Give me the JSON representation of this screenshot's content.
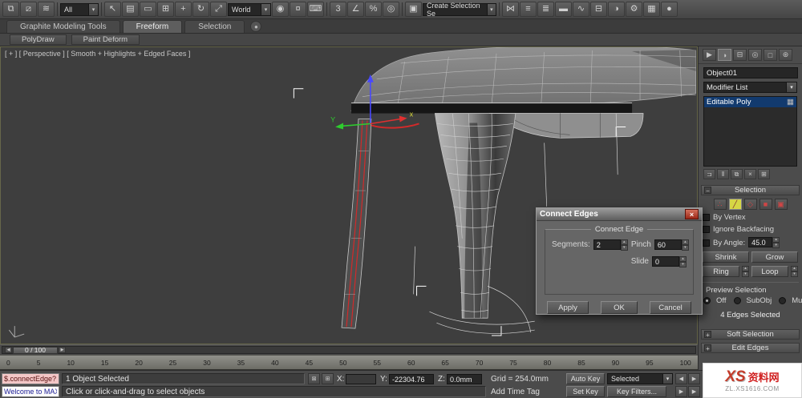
{
  "glyphs": {
    "dropdown_arrow": "▾",
    "spin_up": "▴",
    "spin_down": "▾",
    "collapse": "−",
    "expand": "+",
    "close": "×",
    "lock": "⊠",
    "absolute_mode": "⊞",
    "prev": "◀",
    "next": "▶",
    "modifier_icon": "▦",
    "ribbon_min": "●",
    "slider_left": "◀",
    "slider_right": "▶"
  },
  "toolbar": {
    "selection_filter": "All",
    "coord_system": "World",
    "named_sets": "Create Selection Se",
    "group1": [
      {
        "name": "select-and-link-icon",
        "glyph": "⧉"
      },
      {
        "name": "unlink-selection-icon",
        "glyph": "⧄"
      },
      {
        "name": "bind-to-spacewarp-icon",
        "glyph": "≋"
      }
    ],
    "group2": [
      {
        "name": "select-object-icon",
        "glyph": "↖"
      },
      {
        "name": "select-by-name-icon",
        "glyph": "▤"
      },
      {
        "name": "selection-region-icon",
        "glyph": "▭"
      },
      {
        "name": "window-crossing-icon",
        "glyph": "⊞"
      },
      {
        "name": "select-and-move-icon",
        "glyph": "+"
      },
      {
        "name": "select-and-rotate-icon",
        "glyph": "↻"
      },
      {
        "name": "select-and-scale-icon",
        "glyph": "⤢"
      }
    ],
    "group3": [
      {
        "name": "use-center-icon",
        "glyph": "◉"
      },
      {
        "name": "select-and-manipulate-icon",
        "glyph": "¤"
      },
      {
        "name": "keyboard-override-icon",
        "glyph": "⌨"
      }
    ],
    "group4": [
      {
        "name": "snaps-toggle-icon",
        "glyph": "3"
      },
      {
        "name": "angle-snap-icon",
        "glyph": "∠"
      },
      {
        "name": "percent-snap-icon",
        "glyph": "%"
      },
      {
        "name": "spinner-snap-icon",
        "glyph": "◎"
      }
    ],
    "group5": [
      {
        "name": "edit-named-sets-icon",
        "glyph": "▣"
      }
    ],
    "group6": [
      {
        "name": "mirror-icon",
        "glyph": "⋈"
      },
      {
        "name": "align-icon",
        "glyph": "≡"
      },
      {
        "name": "layer-manager-icon",
        "glyph": "≣"
      },
      {
        "name": "ribbon-toggle-icon",
        "glyph": "▬"
      },
      {
        "name": "curve-editor-icon",
        "glyph": "∿"
      },
      {
        "name": "schematic-view-icon",
        "glyph": "⊟"
      },
      {
        "name": "material-editor-icon",
        "glyph": "◑"
      },
      {
        "name": "render-setup-icon",
        "glyph": "⚙"
      },
      {
        "name": "rendered-frame-icon",
        "glyph": "▦"
      },
      {
        "name": "render-production-icon",
        "glyph": "●"
      }
    ]
  },
  "ribbon": {
    "tabs": [
      {
        "label": "Graphite Modeling Tools"
      },
      {
        "label": "Freeform"
      },
      {
        "label": "Selection"
      }
    ],
    "subtabs": [
      {
        "label": "PolyDraw"
      },
      {
        "label": "Paint Deform"
      }
    ]
  },
  "viewport": {
    "label": "[ + ] [ Perspective ] [ Smooth + Highlights + Edged Faces ]",
    "gizmo_y": "Y",
    "gizmo_x": "x"
  },
  "panel": {
    "tabs": [
      {
        "name": "create-tab-icon",
        "glyph": "▶"
      },
      {
        "name": "modify-tab-icon",
        "glyph": "◑",
        "active": true
      },
      {
        "name": "hierarchy-tab-icon",
        "glyph": "⊟"
      },
      {
        "name": "motion-tab-icon",
        "glyph": "◎"
      },
      {
        "name": "display-tab-icon",
        "glyph": "□"
      },
      {
        "name": "utilities-tab-icon",
        "glyph": "⊛"
      }
    ],
    "object_name": "Object01",
    "modifier_list": "Modifier List",
    "stack_item": "Editable Poly",
    "stack_tools": [
      {
        "name": "pin-stack-icon",
        "glyph": "⊐"
      },
      {
        "name": "show-end-result-icon",
        "glyph": "‖"
      },
      {
        "name": "make-unique-icon",
        "glyph": "⧉"
      },
      {
        "name": "remove-modifier-icon",
        "glyph": "×"
      },
      {
        "name": "configure-modifier-sets-icon",
        "glyph": "⊞"
      }
    ],
    "selection_title": "Selection",
    "subobject": [
      {
        "name": "vertex-mode-icon",
        "glyph": "∴"
      },
      {
        "name": "edge-mode-icon",
        "glyph": "╱",
        "active": true
      },
      {
        "name": "border-mode-icon",
        "glyph": "◇"
      },
      {
        "name": "polygon-mode-icon",
        "glyph": "■"
      },
      {
        "name": "element-mode-icon",
        "glyph": "▣"
      }
    ],
    "by_vertex": "By Vertex",
    "ignore_backfacing": "Ignore Backfacing",
    "by_angle": "By Angle:",
    "angle_value": "45.0",
    "shrink": "Shrink",
    "grow": "Grow",
    "ring": "Ring",
    "loop": "Loop",
    "preview_label": "Preview Selection",
    "preview_off": "Off",
    "preview_subobj": "SubObj",
    "preview_multi": "Multi",
    "selection_status": "4 Edges Selected",
    "soft_selection": "Soft Selection",
    "edit_edges": "Edit Edges"
  },
  "dialog": {
    "title": "Connect Edges",
    "group": "Connect Edge",
    "segments_label": "Segments:",
    "segments_value": "2",
    "pinch_label": "Pinch",
    "pinch_value": "60",
    "slide_label": "Slide",
    "slide_value": "0",
    "apply": "Apply",
    "ok": "OK",
    "cancel": "Cancel"
  },
  "timeline": {
    "handle": "0 / 100",
    "ticks": [
      "0",
      "5",
      "10",
      "15",
      "20",
      "25",
      "30",
      "35",
      "40",
      "45",
      "50",
      "55",
      "60",
      "65",
      "70",
      "75",
      "80",
      "85",
      "90",
      "95",
      "100"
    ]
  },
  "status": {
    "listener_input": "$.connectEdge?",
    "listener_output": "Welcome to MAX!",
    "selection": "1 Object Selected",
    "prompt": "Click or click-and-drag to select objects",
    "x_label": "X:",
    "x_value": "",
    "y_label": "Y:",
    "y_value": "-22304.76",
    "z_label": "Z:",
    "z_value": "0.0mm",
    "grid": "Grid = 254.0mm",
    "add_time_tag": "Add Time Tag",
    "auto_key": "Auto Key",
    "selected_dd": "Selected",
    "set_key": "Set Key",
    "key_filters": "Key Filters..."
  },
  "watermark": {
    "logo": "XS",
    "cn": "资料网",
    "url": "ZL.XS1616.COM"
  }
}
